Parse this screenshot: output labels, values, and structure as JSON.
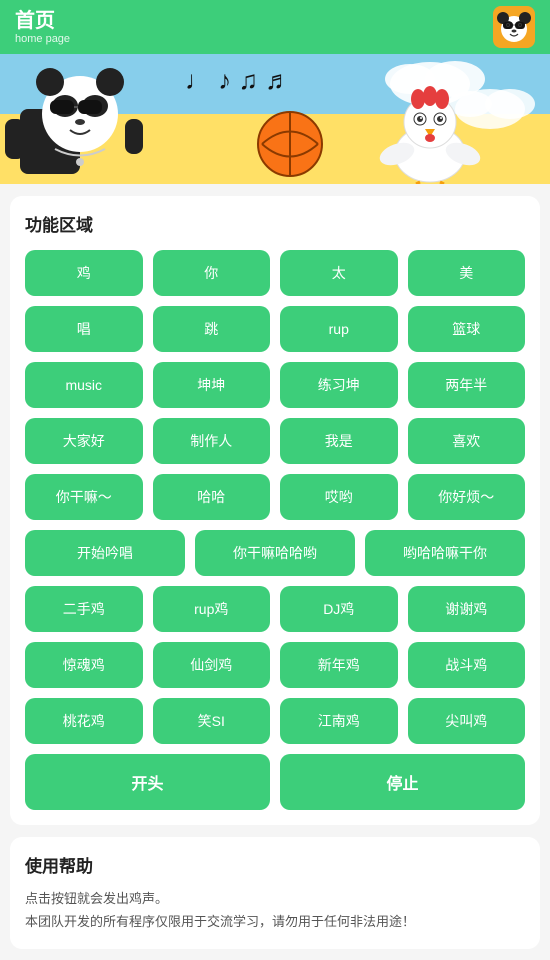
{
  "header": {
    "title_zh": "首页",
    "title_en": "home page",
    "avatar_emoji": "🐼"
  },
  "feature_section": {
    "title": "功能区域",
    "rows": [
      [
        "鸡",
        "你",
        "太",
        "美"
      ],
      [
        "唱",
        "跳",
        "rup",
        "篮球"
      ],
      [
        "music",
        "坤坤",
        "练习坤",
        "两年半"
      ],
      [
        "大家好",
        "制作人",
        "我是",
        "喜欢"
      ],
      [
        "你干嘛～",
        "哈哈",
        "哎哟",
        "你好烦～"
      ],
      [
        "开始吟唱",
        "你干嘛哈哈哟",
        "哟哈哈嘛干你"
      ],
      [
        "二手鸡",
        "rup鸡",
        "DJ鸡",
        "谢谢鸡"
      ],
      [
        "惊魂鸡",
        "仙剑鸡",
        "新年鸡",
        "战斗鸡"
      ],
      [
        "桃花鸡",
        "笑SI",
        "江南鸡",
        "尖叫鸡"
      ]
    ],
    "row5_is3col": true,
    "action_start": "开头",
    "action_stop": "停止"
  },
  "help_section": {
    "title": "使用帮助",
    "lines": [
      "点击按钮就会发出鸡声。",
      "本团队开发的所有程序仅限用于交流学习，请勿用于任何非法用途！"
    ]
  },
  "colors": {
    "green": "#3dce7a",
    "white": "#ffffff",
    "text_dark": "#222222",
    "text_gray": "#555555"
  }
}
